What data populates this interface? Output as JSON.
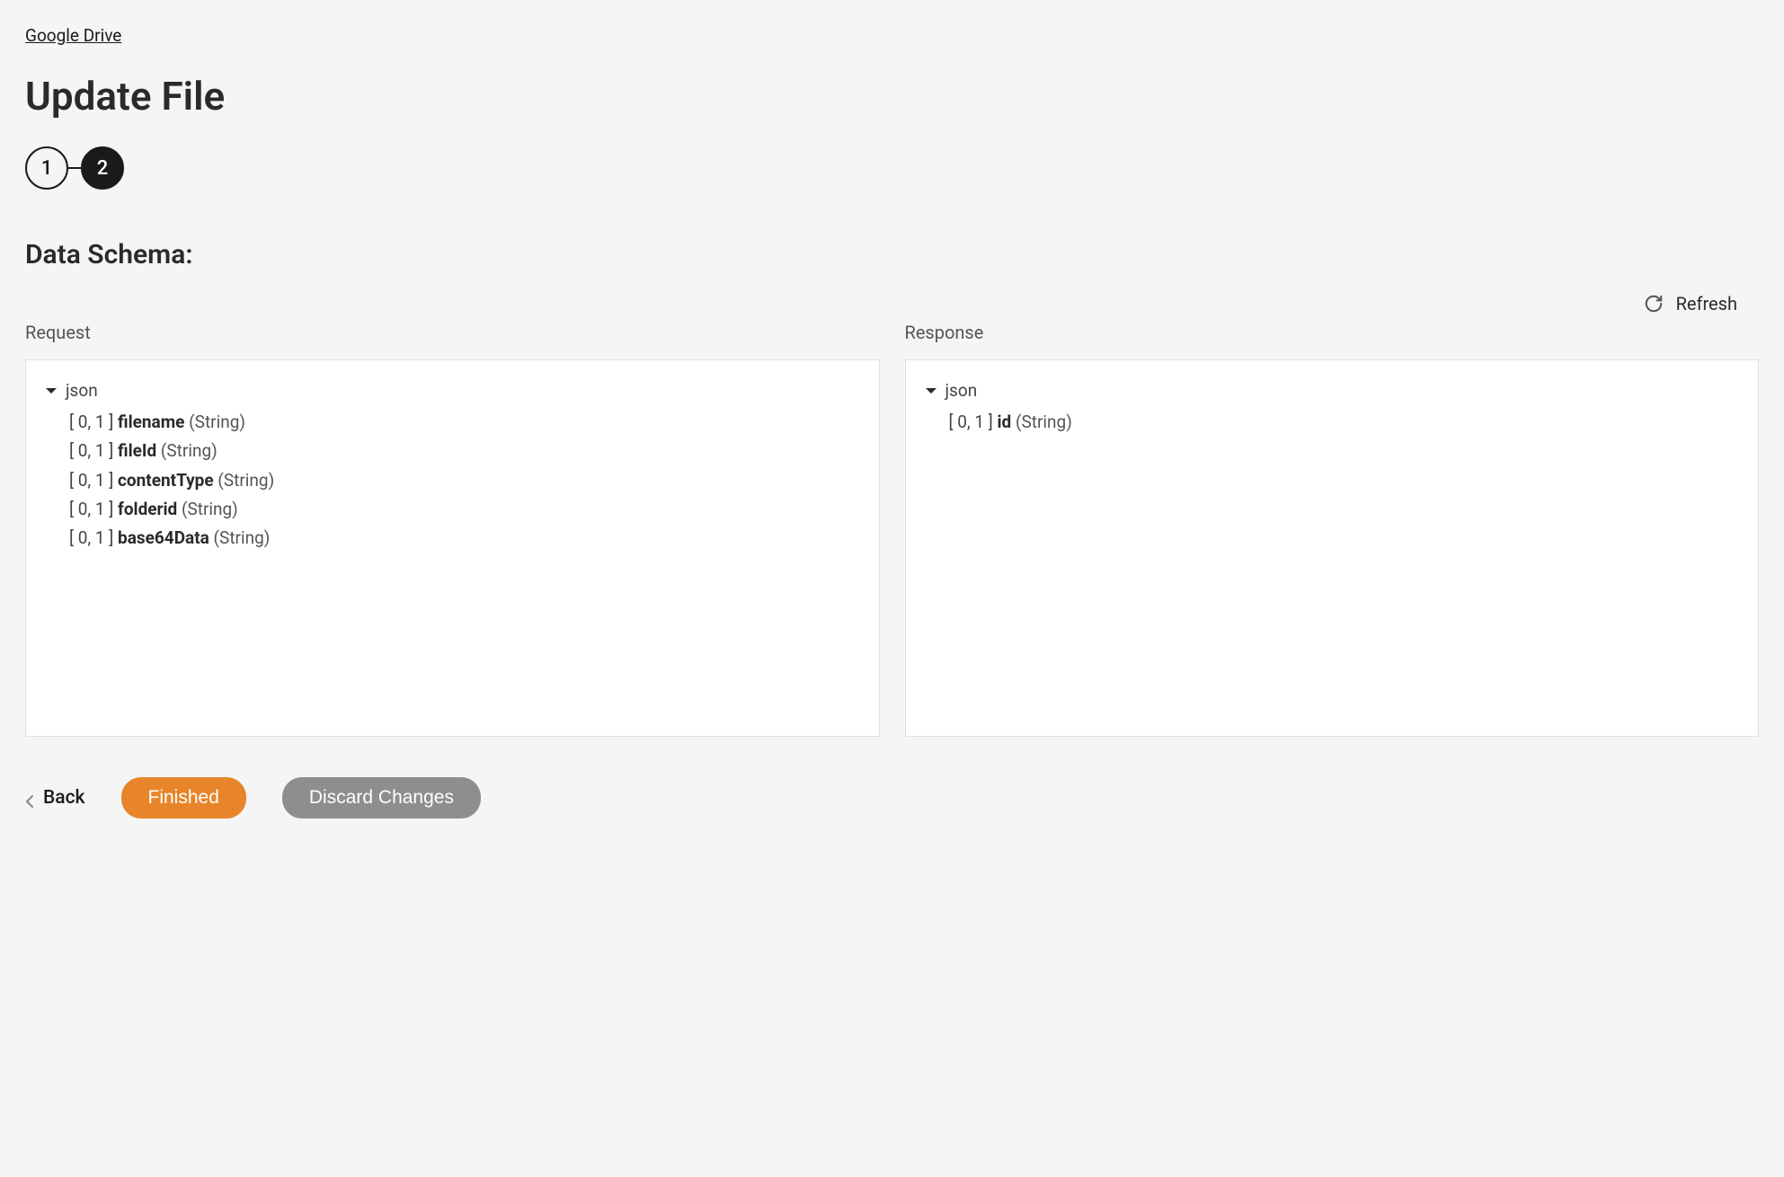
{
  "breadcrumb": "Google Drive",
  "title": "Update File",
  "steps": [
    "1",
    "2"
  ],
  "active_step_index": 1,
  "section_title": "Data Schema:",
  "refresh_label": "Refresh",
  "panels": {
    "request": {
      "label": "Request",
      "root": "json",
      "fields": [
        {
          "card": "[ 0, 1 ]",
          "name": "filename",
          "type": "(String)"
        },
        {
          "card": "[ 0, 1 ]",
          "name": "fileId",
          "type": "(String)"
        },
        {
          "card": "[ 0, 1 ]",
          "name": "contentType",
          "type": "(String)"
        },
        {
          "card": "[ 0, 1 ]",
          "name": "folderid",
          "type": "(String)"
        },
        {
          "card": "[ 0, 1 ]",
          "name": "base64Data",
          "type": "(String)"
        }
      ]
    },
    "response": {
      "label": "Response",
      "root": "json",
      "fields": [
        {
          "card": "[ 0, 1 ]",
          "name": "id",
          "type": "(String)"
        }
      ]
    }
  },
  "footer": {
    "back": "Back",
    "finished": "Finished",
    "discard": "Discard Changes"
  }
}
